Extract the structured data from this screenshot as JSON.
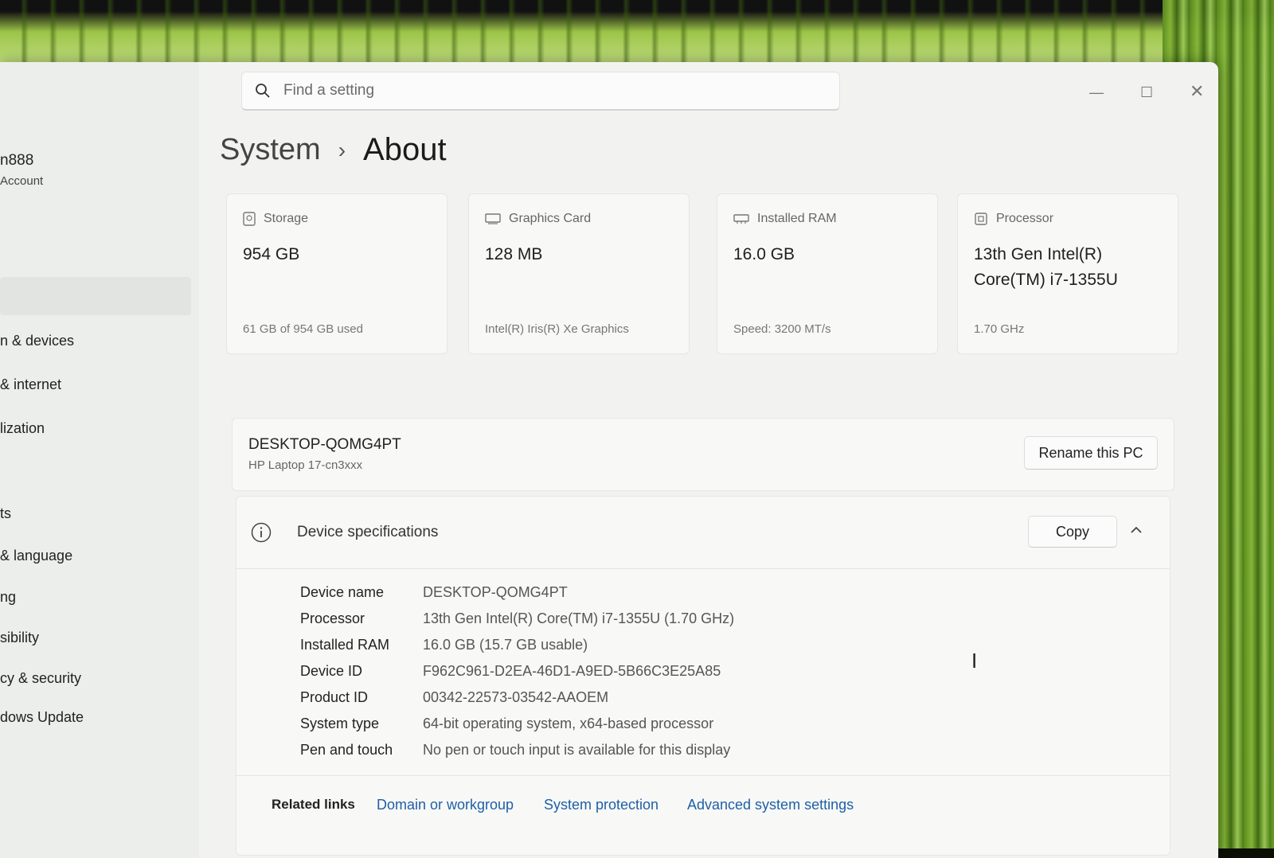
{
  "search": {
    "placeholder": "Find a setting"
  },
  "account": {
    "name": "n888",
    "type": "Account"
  },
  "sidebar": {
    "items": [
      {
        "label": "n & devices"
      },
      {
        "label": "& internet"
      },
      {
        "label": "lization"
      },
      {
        "label": "ts"
      },
      {
        "label": "& language"
      },
      {
        "label": "ng"
      },
      {
        "label": "sibility"
      },
      {
        "label": "cy & security"
      },
      {
        "label": "dows Update"
      }
    ]
  },
  "breadcrumb": {
    "parent": "System",
    "separator": "›",
    "current": "About"
  },
  "cards": [
    {
      "icon": "storage-icon",
      "label": "Storage",
      "value": "954 GB",
      "sub": "61 GB of 954 GB used"
    },
    {
      "icon": "graphics-card-icon",
      "label": "Graphics Card",
      "value": "128 MB",
      "sub": "Intel(R) Iris(R) Xe Graphics"
    },
    {
      "icon": "ram-icon",
      "label": "Installed RAM",
      "value": "16.0 GB",
      "sub": "Speed: 3200 MT/s"
    },
    {
      "icon": "processor-icon",
      "label": "Processor",
      "value": "13th Gen Intel(R) Core(TM) i7-1355U",
      "sub": "1.70 GHz"
    }
  ],
  "pc": {
    "name": "DESKTOP-QOMG4PT",
    "model": "HP Laptop 17-cn3xxx",
    "rename_label": "Rename this PC"
  },
  "specs": {
    "title": "Device specifications",
    "copy_label": "Copy",
    "rows": [
      {
        "label": "Device name",
        "value": "DESKTOP-QOMG4PT"
      },
      {
        "label": "Processor",
        "value": "13th Gen Intel(R) Core(TM) i7-1355U (1.70 GHz)"
      },
      {
        "label": "Installed RAM",
        "value": "16.0 GB (15.7 GB usable)"
      },
      {
        "label": "Device ID",
        "value": "F962C961-D2EA-46D1-A9ED-5B66C3E25A85"
      },
      {
        "label": "Product ID",
        "value": "00342-22573-03542-AAOEM"
      },
      {
        "label": "System type",
        "value": "64-bit operating system, x64-based processor"
      },
      {
        "label": "Pen and touch",
        "value": "No pen or touch input is available for this display"
      }
    ]
  },
  "related": {
    "label": "Related links",
    "links": [
      {
        "label": "Domain or workgroup"
      },
      {
        "label": "System protection"
      },
      {
        "label": "Advanced system settings"
      }
    ]
  },
  "colors": {
    "accent_link": "#1f5fa8",
    "window_bg": "#f2f3f1",
    "card_bg": "#f8f9f7"
  }
}
